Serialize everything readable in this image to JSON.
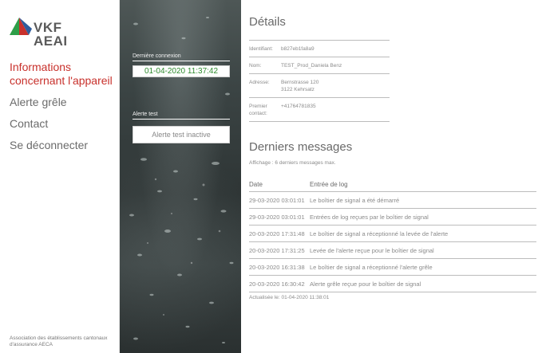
{
  "logo": {
    "line1": "VKF",
    "line2": "AEAI",
    "colors": {
      "green": "#2e9e48",
      "red": "#c8312c",
      "blue": "#2f5d9c"
    }
  },
  "nav": {
    "items": [
      {
        "label": "Informations concernant l'appareil",
        "active": true
      },
      {
        "label": "Alerte grêle"
      },
      {
        "label": "Contact"
      },
      {
        "label": "Se déconnecter"
      }
    ]
  },
  "sidebar": {
    "footer": "Association des établissements cantonaux d'assurance AECA"
  },
  "panel": {
    "last_connection_label": "Dernière connexion",
    "last_connection_value": "01-04-2020 11:37:42",
    "test_alert_label": "Alerte test",
    "test_alert_button": "Alerte test inactive"
  },
  "details": {
    "title": "Détails",
    "rows": [
      {
        "key": "Identifiant:",
        "value": "b827eb1fa8a9"
      },
      {
        "key": "Nom:",
        "value": "TEST_Prod_Daniela Benz"
      },
      {
        "key": "Adresse:",
        "value": "Bernstrasse 120",
        "value2": "3122 Kehrsatz"
      },
      {
        "key": "Premier contact:",
        "value": "+41764781835"
      }
    ]
  },
  "messages": {
    "title": "Derniers messages",
    "subtitle": "Affichage : 6 derniers messages max.",
    "headers": {
      "date": "Date",
      "entry": "Entrée de log"
    },
    "rows": [
      {
        "date": "29-03-2020 03:01:01",
        "entry": "Le boîtier de signal a été démarré"
      },
      {
        "date": "29-03-2020 03:01:01",
        "entry": "Entrées de log reçues par le boîtier de signal"
      },
      {
        "date": "20-03-2020 17:31:48",
        "entry": "Le boîtier de signal a réceptionné la levée de l'alerte"
      },
      {
        "date": "20-03-2020 17:31:25",
        "entry": "Levée de l'alerte reçue pour le boîtier de signal"
      },
      {
        "date": "20-03-2020 16:31:38",
        "entry": "Le boîtier de signal a réceptionné l'alerte grêle"
      },
      {
        "date": "20-03-2020 16:30:42",
        "entry": "Alerte grêle reçue pour le boîtier de signal"
      }
    ],
    "updated": "Actualisée le: 01-04-2020 11:38:01"
  },
  "colors": {
    "accent_red": "#c8312c",
    "timestamp_green": "#2e8b2e"
  }
}
